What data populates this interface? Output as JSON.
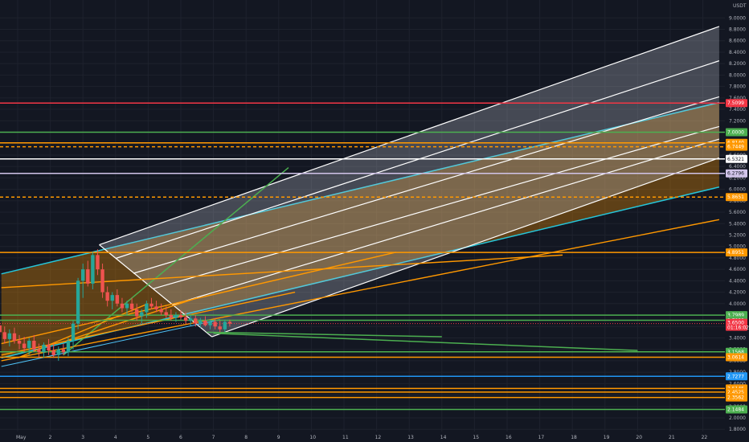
{
  "chart_data": {
    "type": "candlestick",
    "currency_label": "USDT",
    "y_axis": {
      "min": 1.75,
      "max": 9.1,
      "ticks": [
        "1.8000",
        "2.0000",
        "2.2000",
        "2.4000",
        "2.6000",
        "2.8000",
        "3.0000",
        "3.2000",
        "3.4000",
        "3.6000",
        "3.8000",
        "4.0000",
        "4.2000",
        "4.4000",
        "4.6000",
        "4.8000",
        "5.0000",
        "5.2000",
        "5.4000",
        "5.6000",
        "5.8000",
        "6.0000",
        "6.2000",
        "6.4000",
        "6.6000",
        "6.8000",
        "7.0000",
        "7.2000",
        "7.4000",
        "7.6000",
        "7.8000",
        "8.0000",
        "8.2000",
        "8.4000",
        "8.6000",
        "8.8000",
        "9.0000"
      ]
    },
    "x_axis": {
      "ticks": [
        {
          "day": 1,
          "label": "May"
        },
        {
          "day": 2,
          "label": "2"
        },
        {
          "day": 3,
          "label": "3"
        },
        {
          "day": 4,
          "label": "4"
        },
        {
          "day": 5,
          "label": "5"
        },
        {
          "day": 6,
          "label": "6"
        },
        {
          "day": 7,
          "label": "7"
        },
        {
          "day": 8,
          "label": "8"
        },
        {
          "day": 9,
          "label": "9"
        },
        {
          "day": 10,
          "label": "10"
        },
        {
          "day": 11,
          "label": "11"
        },
        {
          "day": 12,
          "label": "12"
        },
        {
          "day": 13,
          "label": "13"
        },
        {
          "day": 14,
          "label": "14"
        },
        {
          "day": 15,
          "label": "15"
        },
        {
          "day": 16,
          "label": "16"
        },
        {
          "day": 17,
          "label": "17"
        },
        {
          "day": 18,
          "label": "18"
        },
        {
          "day": 19,
          "label": "19"
        },
        {
          "day": 20,
          "label": "20"
        },
        {
          "day": 21,
          "label": "21"
        },
        {
          "day": 22,
          "label": "22"
        }
      ]
    },
    "candles": [
      {
        "t": 0.15,
        "o": 3.35,
        "h": 3.65,
        "l": 3.2,
        "c": 3.55
      },
      {
        "t": 0.3,
        "o": 3.55,
        "h": 3.7,
        "l": 3.4,
        "c": 3.62
      },
      {
        "t": 0.45,
        "o": 3.62,
        "h": 3.72,
        "l": 3.45,
        "c": 3.5
      },
      {
        "t": 0.6,
        "o": 3.5,
        "h": 3.6,
        "l": 3.3,
        "c": 3.38
      },
      {
        "t": 0.75,
        "o": 3.38,
        "h": 3.55,
        "l": 3.25,
        "c": 3.48
      },
      {
        "t": 0.9,
        "o": 3.48,
        "h": 3.58,
        "l": 3.3,
        "c": 3.35
      },
      {
        "t": 1.05,
        "o": 3.35,
        "h": 3.45,
        "l": 3.2,
        "c": 3.3
      },
      {
        "t": 1.2,
        "o": 3.3,
        "h": 3.42,
        "l": 3.15,
        "c": 3.22
      },
      {
        "t": 1.35,
        "o": 3.22,
        "h": 3.4,
        "l": 3.1,
        "c": 3.35
      },
      {
        "t": 1.5,
        "o": 3.35,
        "h": 3.45,
        "l": 3.15,
        "c": 3.2
      },
      {
        "t": 1.65,
        "o": 3.2,
        "h": 3.3,
        "l": 3.05,
        "c": 3.15
      },
      {
        "t": 1.8,
        "o": 3.15,
        "h": 3.32,
        "l": 3.05,
        "c": 3.28
      },
      {
        "t": 1.95,
        "o": 3.28,
        "h": 3.38,
        "l": 3.1,
        "c": 3.18
      },
      {
        "t": 2.1,
        "o": 3.18,
        "h": 3.3,
        "l": 3.05,
        "c": 3.1
      },
      {
        "t": 2.25,
        "o": 3.1,
        "h": 3.25,
        "l": 3.0,
        "c": 3.2
      },
      {
        "t": 2.4,
        "o": 3.2,
        "h": 3.3,
        "l": 3.1,
        "c": 3.15
      },
      {
        "t": 2.55,
        "o": 3.15,
        "h": 3.4,
        "l": 3.08,
        "c": 3.35
      },
      {
        "t": 2.7,
        "o": 3.35,
        "h": 3.7,
        "l": 3.2,
        "c": 3.65
      },
      {
        "t": 2.85,
        "o": 3.65,
        "h": 4.45,
        "l": 3.55,
        "c": 4.4
      },
      {
        "t": 3.0,
        "o": 4.4,
        "h": 4.7,
        "l": 4.1,
        "c": 4.6
      },
      {
        "t": 3.15,
        "o": 4.6,
        "h": 4.75,
        "l": 4.3,
        "c": 4.35
      },
      {
        "t": 3.3,
        "o": 4.35,
        "h": 4.9,
        "l": 4.25,
        "c": 4.85
      },
      {
        "t": 3.45,
        "o": 4.85,
        "h": 4.95,
        "l": 4.5,
        "c": 4.6
      },
      {
        "t": 3.6,
        "o": 4.6,
        "h": 4.7,
        "l": 4.1,
        "c": 4.2
      },
      {
        "t": 3.75,
        "o": 4.2,
        "h": 4.3,
        "l": 3.95,
        "c": 4.05
      },
      {
        "t": 3.9,
        "o": 4.05,
        "h": 4.2,
        "l": 3.9,
        "c": 4.15
      },
      {
        "t": 4.05,
        "o": 4.15,
        "h": 4.25,
        "l": 3.95,
        "c": 4.0
      },
      {
        "t": 4.2,
        "o": 4.0,
        "h": 4.1,
        "l": 3.85,
        "c": 3.92
      },
      {
        "t": 4.35,
        "o": 3.92,
        "h": 4.05,
        "l": 3.8,
        "c": 4.0
      },
      {
        "t": 4.5,
        "o": 4.0,
        "h": 4.1,
        "l": 3.85,
        "c": 3.9
      },
      {
        "t": 4.65,
        "o": 3.9,
        "h": 4.0,
        "l": 3.7,
        "c": 3.78
      },
      {
        "t": 4.8,
        "o": 3.78,
        "h": 3.9,
        "l": 3.65,
        "c": 3.85
      },
      {
        "t": 4.95,
        "o": 3.85,
        "h": 4.05,
        "l": 3.75,
        "c": 4.0
      },
      {
        "t": 5.1,
        "o": 4.0,
        "h": 4.1,
        "l": 3.9,
        "c": 3.95
      },
      {
        "t": 5.25,
        "o": 3.95,
        "h": 4.05,
        "l": 3.85,
        "c": 3.9
      },
      {
        "t": 5.4,
        "o": 3.9,
        "h": 4.0,
        "l": 3.8,
        "c": 3.85
      },
      {
        "t": 5.55,
        "o": 3.85,
        "h": 3.95,
        "l": 3.75,
        "c": 3.8
      },
      {
        "t": 5.7,
        "o": 3.8,
        "h": 3.9,
        "l": 3.7,
        "c": 3.75
      },
      {
        "t": 5.85,
        "o": 3.75,
        "h": 3.85,
        "l": 3.68,
        "c": 3.8
      },
      {
        "t": 6.0,
        "o": 3.8,
        "h": 3.88,
        "l": 3.72,
        "c": 3.76
      },
      {
        "t": 6.15,
        "o": 3.76,
        "h": 3.85,
        "l": 3.65,
        "c": 3.7
      },
      {
        "t": 6.3,
        "o": 3.7,
        "h": 3.8,
        "l": 3.62,
        "c": 3.74
      },
      {
        "t": 6.45,
        "o": 3.74,
        "h": 3.8,
        "l": 3.6,
        "c": 3.65
      },
      {
        "t": 6.6,
        "o": 3.65,
        "h": 3.75,
        "l": 3.58,
        "c": 3.7
      },
      {
        "t": 6.75,
        "o": 3.7,
        "h": 3.78,
        "l": 3.6,
        "c": 3.62
      },
      {
        "t": 6.9,
        "o": 3.62,
        "h": 3.72,
        "l": 3.55,
        "c": 3.68
      },
      {
        "t": 7.05,
        "o": 3.68,
        "h": 3.75,
        "l": 3.55,
        "c": 3.6
      },
      {
        "t": 7.2,
        "o": 3.6,
        "h": 3.7,
        "l": 3.5,
        "c": 3.55
      },
      {
        "t": 7.35,
        "o": 3.55,
        "h": 3.72,
        "l": 3.5,
        "c": 3.68
      },
      {
        "t": 7.5,
        "o": 3.68,
        "h": 3.72,
        "l": 3.6,
        "c": 3.65
      }
    ],
    "horizontal_levels": [
      {
        "value": 7.5099,
        "label": "7.5099",
        "color": "#f23645"
      },
      {
        "value": 7.0,
        "label": "7.0000",
        "color": "#4caf50"
      },
      {
        "value": 6.814,
        "label": "6.8140",
        "color": "#ff9800"
      },
      {
        "value": 6.7449,
        "label": "6.7449",
        "color": "#ff9800",
        "dashed": true
      },
      {
        "value": 6.5321,
        "label": "6.5321",
        "color": "#ffffff"
      },
      {
        "value": 6.2796,
        "label": "6.2796",
        "color": "#d1c4e9"
      },
      {
        "value": 5.8651,
        "label": "5.8651",
        "color": "#ff9800",
        "dashed": true
      },
      {
        "value": 4.8951,
        "label": "4.8951",
        "color": "#ff9800"
      },
      {
        "value": 3.7989,
        "label": "3.7989",
        "color": "#4caf50"
      },
      {
        "value": 3.7089,
        "label": "3.7089",
        "color": "#4caf50"
      },
      {
        "value": 3.1568,
        "label": "3.1568",
        "color": "#4caf50"
      },
      {
        "value": 3.0614,
        "label": "3.0614",
        "color": "#ff9800"
      },
      {
        "value": 2.7277,
        "label": "2.7277",
        "color": "#2196f3"
      },
      {
        "value": 2.5145,
        "label": "2.5145",
        "color": "#ff9800"
      },
      {
        "value": 2.4525,
        "label": "2.4525",
        "color": "#ff9800"
      },
      {
        "value": 2.3562,
        "label": "2.3562",
        "color": "#ff9800"
      },
      {
        "value": 2.1484,
        "label": "2.1484",
        "color": "#4caf50"
      }
    ],
    "current_price": {
      "value": 3.65,
      "label": "3.6500",
      "countdown": "01:16:02",
      "color": "#f23645"
    },
    "colors": {
      "background": "#131722",
      "grid": "#1e222d",
      "up": "#26a69a",
      "down": "#ef5350",
      "pitchfork": "#ffffff",
      "channel": "#ff9800",
      "channel_edge": "#26c6da",
      "trend_green": "#4caf50"
    }
  }
}
